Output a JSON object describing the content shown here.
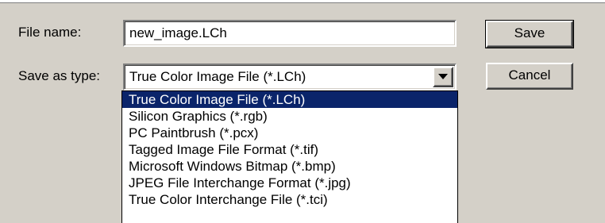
{
  "dialog": {
    "file_name_label": "File name:",
    "file_name_value": "new_image.LCh",
    "save_as_type_label": "Save as type:",
    "save_as_type_value": "True Color Image File (*.LCh)",
    "save_label": "Save",
    "cancel_label": "Cancel",
    "dropdown_icon": "chevron-down-icon",
    "selected_index": 0,
    "type_options": [
      "True Color Image File (*.LCh)",
      "Silicon Graphics (*.rgb)",
      "PC Paintbrush (*.pcx)",
      "Tagged Image File Format (*.tif)",
      "Microsoft Windows Bitmap (*.bmp)",
      "JPEG File Interchange Format (*.jpg)",
      "True Color Interchange File (*.tci)"
    ]
  },
  "colors": {
    "dialog_bg": "#d4d0c8",
    "selection_bg": "#0a246a",
    "selection_text": "#ffffff"
  }
}
